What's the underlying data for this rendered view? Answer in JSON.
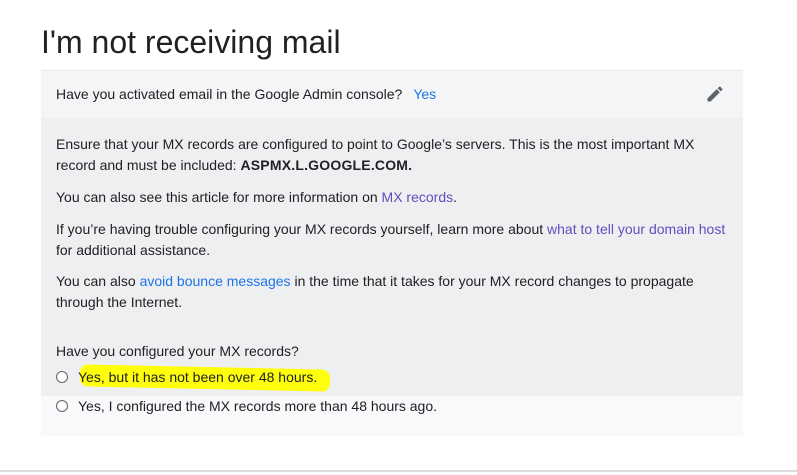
{
  "page": {
    "title": "I'm not receiving mail"
  },
  "question1": {
    "text": "Have you activated email in the Google Admin console?",
    "answer": "Yes",
    "edit_icon": "pencil-icon"
  },
  "info": {
    "p1_text": "Ensure that your MX records are configured to point to Google’s servers. This is the most important MX record and must be included: ",
    "p1_bold": "ASPMX.L.GOOGLE.COM.",
    "p2_prefix": "You can also see this article for more information on ",
    "p2_link": "MX records",
    "p2_suffix": ".",
    "p3_prefix": "If you’re having trouble configuring your MX records yourself, learn more about ",
    "p3_link": "what to tell your domain host",
    "p3_suffix": " for additional assistance.",
    "p4_prefix": "You can also ",
    "p4_link": "avoid bounce messages",
    "p4_suffix": " in the time that it takes for your MX record changes to propagate through the Internet."
  },
  "question2": {
    "text": "Have you configured your MX records?",
    "options": [
      "Yes, but it has not been over 48 hours.",
      "Yes, I configured the MX records more than 48 hours ago."
    ]
  },
  "colors": {
    "link": "#1a73e8",
    "visited_link": "#5f4fbf",
    "highlight": "#ffff00"
  }
}
